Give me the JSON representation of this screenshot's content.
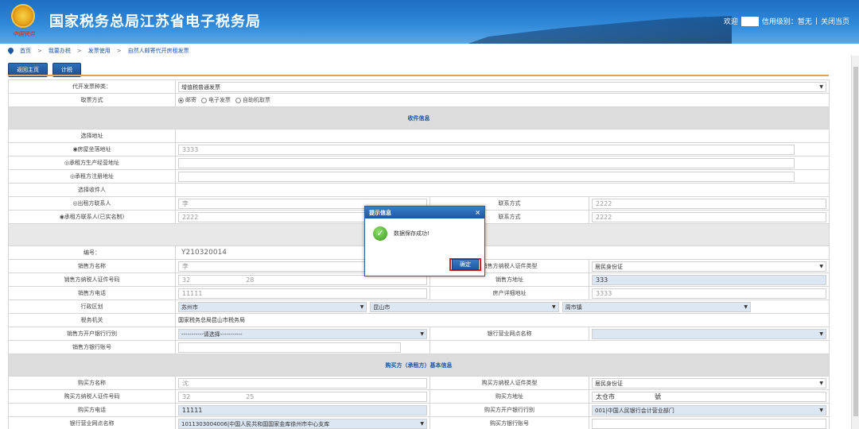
{
  "header": {
    "site_title": "国家税务总局江苏省电子税务局",
    "emblem_text": "中国税务",
    "welcome": "欢迎",
    "credit_level": "信用级别：暂无",
    "link_sep": "|",
    "close_page": "关闭当页"
  },
  "breadcrumb": [
    "首页",
    "我要办税",
    "发票使用",
    "自然人邮寄代开房租发票"
  ],
  "breadcrumb_sep": ">",
  "toolbar": {
    "back_home": "返回主页",
    "calc": "计税"
  },
  "form": {
    "invoice_type_label": "代开发票种类：",
    "invoice_type_value": "增值税普通发票",
    "delivery_label": "取票方式",
    "delivery_options": [
      "邮寄",
      "电子发票",
      "自助机取票"
    ],
    "recipient_section": "收件信息",
    "select_address_label": "选择地址",
    "addr_property": "◉房屋坐落地址",
    "addr_property_value": "3333",
    "addr_tenant_business": "◎承租方生产经营地址",
    "addr_tenant_registered": "◎承租方注册地址",
    "select_recipient_label": "选择收件人",
    "lessor_contact": "◎出租方联系人",
    "lessor_contact_value": "李",
    "contact_label": "联系方式",
    "lessor_phone_value": "2222",
    "tenant_contact": "◉承租方联系人(已实名制)",
    "tenant_contact_value": "2222",
    "tenant_phone_value": "2222",
    "number_label": "编号：",
    "number_value": "Y210320014",
    "seller_name_label": "销售方名称",
    "seller_name_value": "李",
    "seller_id_type_label": "销售方纳税人证件类型",
    "seller_id_type_value": "居民身份证",
    "seller_id_no_label": "销售方纳税人证件号码",
    "seller_id_no_a": "32",
    "seller_id_no_b": "28",
    "seller_addr_label": "销售方地址",
    "seller_addr_value": "333",
    "seller_phone_label": "销售方电话",
    "seller_phone_value": "11111",
    "property_addr_label": "房产详细地址",
    "property_addr_value": "3333",
    "region_label": "行政区划",
    "region_city": "苏州市",
    "region_county": "昆山市",
    "region_town": "周市镇",
    "tax_office_label": "税务机关",
    "tax_office_value": "国家税务总局昆山市税务局",
    "seller_bank_label": "销售方开户银行行别",
    "seller_bank_value": "-----------请选择-----------",
    "bank_branch_label": "银行营业网点名称",
    "seller_account_label": "销售方银行账号",
    "buyer_section": "购买方（承租方）基本信息",
    "buyer_name_label": "购买方名称",
    "buyer_name_value": "沈",
    "buyer_id_type_label": "购买方纳税人证件类型",
    "buyer_id_type_value": "居民身份证",
    "buyer_id_no_label": "购买方纳税人证件号码",
    "buyer_id_no_a": "32",
    "buyer_id_no_b": "25",
    "buyer_addr_label": "购买方地址",
    "buyer_addr_a": "太仓市",
    "buyer_addr_b": "號",
    "buyer_phone_label": "购买方电话",
    "buyer_phone_value": "11111",
    "buyer_bank_label": "购买方开户银行行别",
    "buyer_bank_value": "001|中国人民银行会计营业部门",
    "buyer_branch_label": "银行营业网点名称",
    "buyer_branch_value": "1011303004006|中国人民共和国国家金库徐州市中心支库",
    "buyer_account_label": "购买方银行账号"
  },
  "dialog": {
    "title": "提示信息",
    "close": "×",
    "message": "数据保存成功!",
    "ok": "确定"
  }
}
